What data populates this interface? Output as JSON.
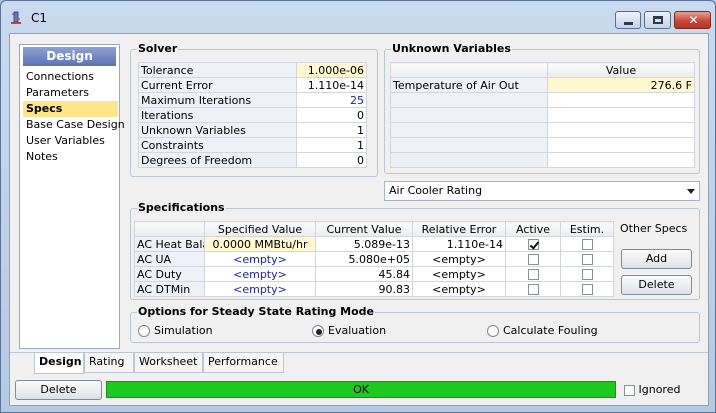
{
  "window": {
    "title": "C1"
  },
  "nav": {
    "header": "Design",
    "items": [
      "Connections",
      "Parameters",
      "Specs",
      "Base Case Design",
      "User Variables",
      "Notes"
    ],
    "active_index": 2
  },
  "solver": {
    "title": "Solver",
    "rows": [
      {
        "label": "Tolerance",
        "value": "1.000e-06"
      },
      {
        "label": "Current Error",
        "value": "1.110e-14"
      },
      {
        "label": "Maximum Iterations",
        "value": "25"
      },
      {
        "label": "Iterations",
        "value": "0"
      },
      {
        "label": "Unknown Variables",
        "value": "1"
      },
      {
        "label": "Constraints",
        "value": "1"
      },
      {
        "label": "Degrees of Freedom",
        "value": "0"
      }
    ]
  },
  "unknown_variables": {
    "title": "Unknown Variables",
    "value_header": "Value",
    "rows": [
      {
        "label": "Temperature of Air Out",
        "value": "276.6 F"
      }
    ]
  },
  "mode_dropdown": {
    "selected": "Air Cooler Rating"
  },
  "specifications": {
    "title": "Specifications",
    "columns": [
      "Specified Value",
      "Current Value",
      "Relative Error",
      "Active",
      "Estim."
    ],
    "rows": [
      {
        "name": "AC Heat Balance",
        "specified": "0.0000 MMBtu/hr",
        "current": "5.089e-13",
        "error": "1.110e-14",
        "active": true,
        "estim": false
      },
      {
        "name": "AC UA",
        "specified": "<empty>",
        "current": "5.080e+05",
        "error": "<empty>",
        "active": false,
        "estim": false
      },
      {
        "name": "AC Duty",
        "specified": "<empty>",
        "current": "45.84",
        "error": "<empty>",
        "active": false,
        "estim": false
      },
      {
        "name": "AC DTMin",
        "specified": "<empty>",
        "current": "90.83",
        "error": "<empty>",
        "active": false,
        "estim": false
      }
    ],
    "other_specs_label": "Other Specs",
    "add_label": "Add",
    "delete_label": "Delete"
  },
  "rating_mode": {
    "title": "Options for Steady State Rating Mode",
    "options": [
      "Simulation",
      "Evaluation",
      "Calculate Fouling"
    ],
    "selected_index": 1
  },
  "tabs": {
    "items": [
      "Design",
      "Rating",
      "Worksheet",
      "Performance"
    ],
    "active_index": 0
  },
  "footer": {
    "delete_label": "Delete",
    "status": "OK",
    "ignored_label": "Ignored",
    "ignored": false
  },
  "colors": {
    "status_ok": "#1cc91c",
    "nav_active": "#ffe58a",
    "nav_header": "#5d73b3",
    "close_button": "#c7493a"
  }
}
